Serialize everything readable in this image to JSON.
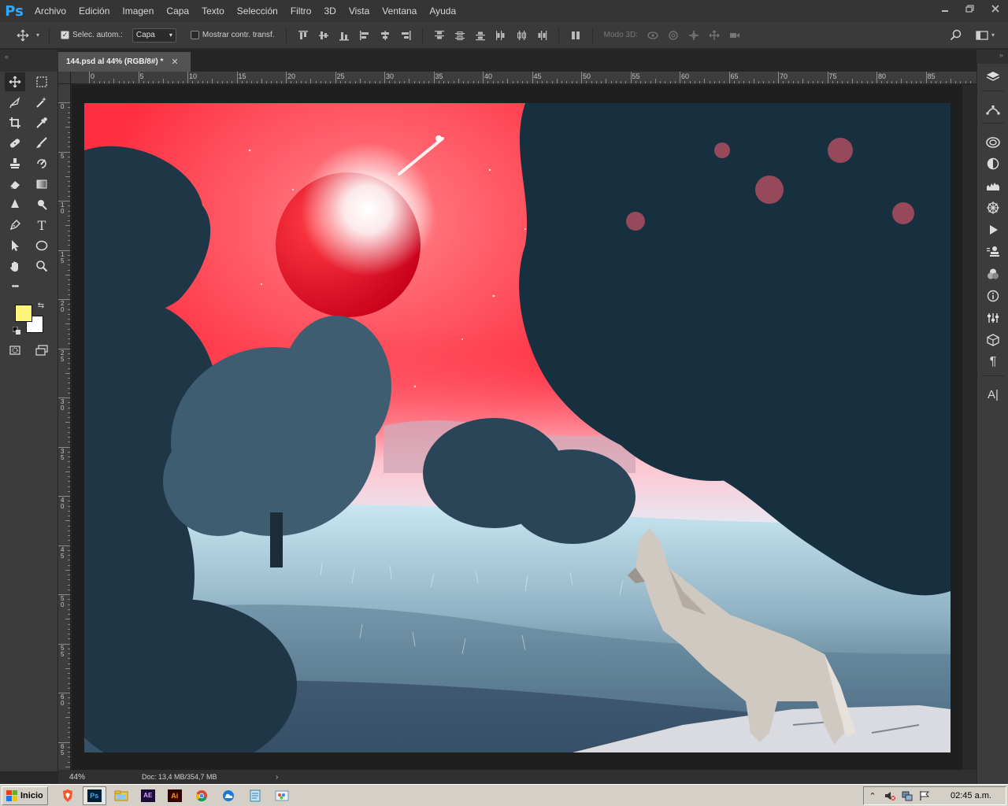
{
  "app": {
    "logo": "Ps",
    "menus": [
      "Archivo",
      "Edición",
      "Imagen",
      "Capa",
      "Texto",
      "Selección",
      "Filtro",
      "3D",
      "Vista",
      "Ventana",
      "Ayuda"
    ],
    "window_controls": [
      "minimize-icon",
      "restore-icon",
      "close-icon"
    ]
  },
  "options": {
    "auto_select_label": "Selec. autom.:",
    "auto_select_checked": true,
    "layer_select_value": "Capa",
    "show_transform_label": "Mostrar contr. transf.",
    "show_transform_checked": false,
    "mode3d_label": "Modo 3D:"
  },
  "document": {
    "tab_label": "144.psd al 44% (RGB/8#) *",
    "zoom": "44%",
    "doc_info": "Doc: 13,4 MB/354,7 MB"
  },
  "rulers": {
    "h_labels": [
      "0",
      "5",
      "10",
      "15",
      "20",
      "25",
      "30",
      "35",
      "40",
      "45",
      "50",
      "55",
      "60",
      "65",
      "70",
      "75",
      "80",
      "85"
    ],
    "v_labels": [
      "0",
      "5",
      "10",
      "15",
      "20",
      "25",
      "30",
      "35",
      "40",
      "45",
      "50",
      "55",
      "60",
      "65"
    ]
  },
  "colors": {
    "foreground": "#fdf57a",
    "background": "#ffffff",
    "accent": "#31a8ff"
  },
  "tools": [
    "move-icon",
    "marquee-icon",
    "lasso-icon",
    "magic-wand-icon",
    "crop-icon",
    "eyedropper-icon",
    "healing-icon",
    "brush-icon",
    "clone-stamp-icon",
    "history-brush-icon",
    "eraser-icon",
    "gradient-icon",
    "blur-icon",
    "dodge-icon",
    "pen-icon",
    "type-icon",
    "path-select-icon",
    "ellipse-icon",
    "hand-icon",
    "zoom-icon",
    "more-tools-icon"
  ],
  "tool_glyphs": {
    "type": "T",
    "more": "•••"
  },
  "right_panels": [
    "layers-icon",
    "paths-icon",
    "libraries-icon",
    "adjustments-icon",
    "histogram-icon",
    "navigator-icon",
    "actions-icon",
    "clone-source-icon",
    "color-icon",
    "info-icon",
    "properties-icon",
    "3d-icon",
    "paragraph-icon",
    "character-icon"
  ],
  "panel_glyphs": {
    "paragraph": "¶",
    "character": "A|"
  },
  "taskbar": {
    "start_label": "Inicio",
    "apps": [
      "brave-icon",
      "photoshop-icon",
      "explorer-icon",
      "after-effects-icon",
      "illustrator-icon",
      "chrome-icon",
      "onedrive-icon",
      "notepad-icon",
      "paint-icon"
    ],
    "app_glyphs": {
      "after_effects": "AE",
      "illustrator": "Ai",
      "photoshop": "Ps"
    },
    "clock": "02:45 a.m."
  }
}
